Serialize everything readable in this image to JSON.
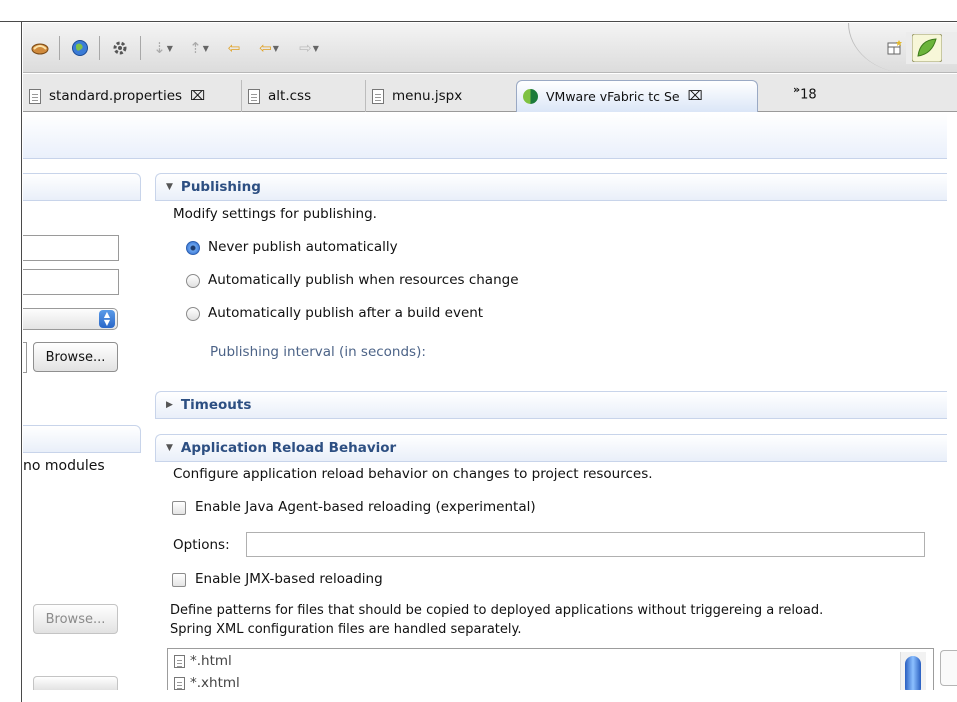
{
  "tabs": [
    {
      "label": "standard.properties",
      "icon": "file-icon",
      "close": "close-icon"
    },
    {
      "label": "alt.css",
      "icon": "file-icon"
    },
    {
      "label": "menu.jspx",
      "icon": "file-icon"
    },
    {
      "label": "VMware vFabric tc Se",
      "icon": "vmware-icon",
      "close": "close-icon",
      "active": true
    }
  ],
  "tab_overflow": {
    "glyph": "»",
    "count": "18"
  },
  "left": {
    "browse_label": "Browse...",
    "no_modules": "no modules",
    "browse_disabled_label": "Browse..."
  },
  "publishing": {
    "title": "Publishing",
    "description": "Modify settings for publishing.",
    "options": [
      {
        "label": "Never publish automatically",
        "selected": true
      },
      {
        "label": "Automatically publish when resources change",
        "selected": false
      },
      {
        "label": "Automatically publish after a build event",
        "selected": false
      }
    ],
    "interval_label": "Publishing interval (in seconds):"
  },
  "timeouts": {
    "title": "Timeouts"
  },
  "reload": {
    "title": "Application Reload Behavior",
    "description": "Configure application reload behavior on changes to project resources.",
    "java_agent_label": "Enable Java Agent-based reloading (experimental)",
    "java_agent_checked": false,
    "options_label": "Options:",
    "options_value": "",
    "jmx_label": "Enable JMX-based reloading",
    "jmx_checked": false,
    "patterns_line1": "Define patterns for files that should be copied to deployed applications without triggereing a reload.",
    "patterns_line2": "Spring XML configuration files are handled separately.",
    "patterns": [
      "*.html",
      "*.xhtml"
    ]
  },
  "colors": {
    "section_title": "#2d4f82",
    "accent": "#3a76d3"
  }
}
